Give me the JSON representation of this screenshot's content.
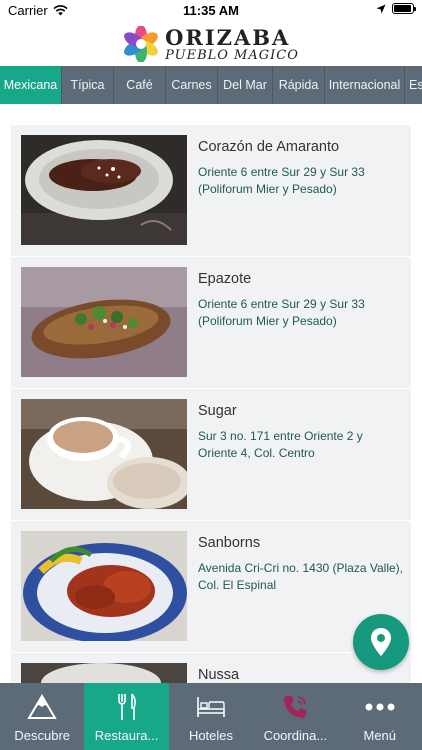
{
  "status_bar": {
    "carrier": "Carrier",
    "time": "11:35 AM"
  },
  "header": {
    "logo_title": "ORIZABA",
    "logo_subtitle": "PUEBLO MAGICO"
  },
  "tabs": [
    {
      "label": "Mexicana",
      "active": true
    },
    {
      "label": "Típica",
      "active": false
    },
    {
      "label": "Café",
      "active": false
    },
    {
      "label": "Carnes",
      "active": false
    },
    {
      "label": "Del Mar",
      "active": false
    },
    {
      "label": "Rápida",
      "active": false
    },
    {
      "label": "Internacional",
      "active": false
    },
    {
      "label": "Es",
      "active": false
    }
  ],
  "restaurants": [
    {
      "name": "Corazón de Amaranto",
      "address": "Oriente 6 entre Sur 29 y Sur 33 (Poliforum Mier y Pesado)"
    },
    {
      "name": "Epazote",
      "address": "Oriente 6 entre Sur 29 y Sur 33 (Poliforum Mier y Pesado)"
    },
    {
      "name": "Sugar",
      "address": "Sur 3 no. 171 entre Oriente 2 y Oriente 4, Col. Centro"
    },
    {
      "name": "Sanborns",
      "address": "Avenida Cri-Cri no. 1430 (Plaza Valle), Col. El Espinal"
    },
    {
      "name": "Nussa",
      "address": ""
    }
  ],
  "bottom_nav": [
    {
      "label": "Descubre",
      "icon": "mountain-icon",
      "active": false
    },
    {
      "label": "Restaura...",
      "icon": "fork-knife-icon",
      "active": true
    },
    {
      "label": "Hoteles",
      "icon": "bed-icon",
      "active": false
    },
    {
      "label": "Coordina...",
      "icon": "phone-icon",
      "active": false
    },
    {
      "label": "Menú",
      "icon": "more-dots-icon",
      "active": false
    }
  ],
  "colors": {
    "accent": "#17a789",
    "bar": "#5d6b79",
    "address_text": "#1e5a4f",
    "phone_icon": "#a0265a"
  }
}
